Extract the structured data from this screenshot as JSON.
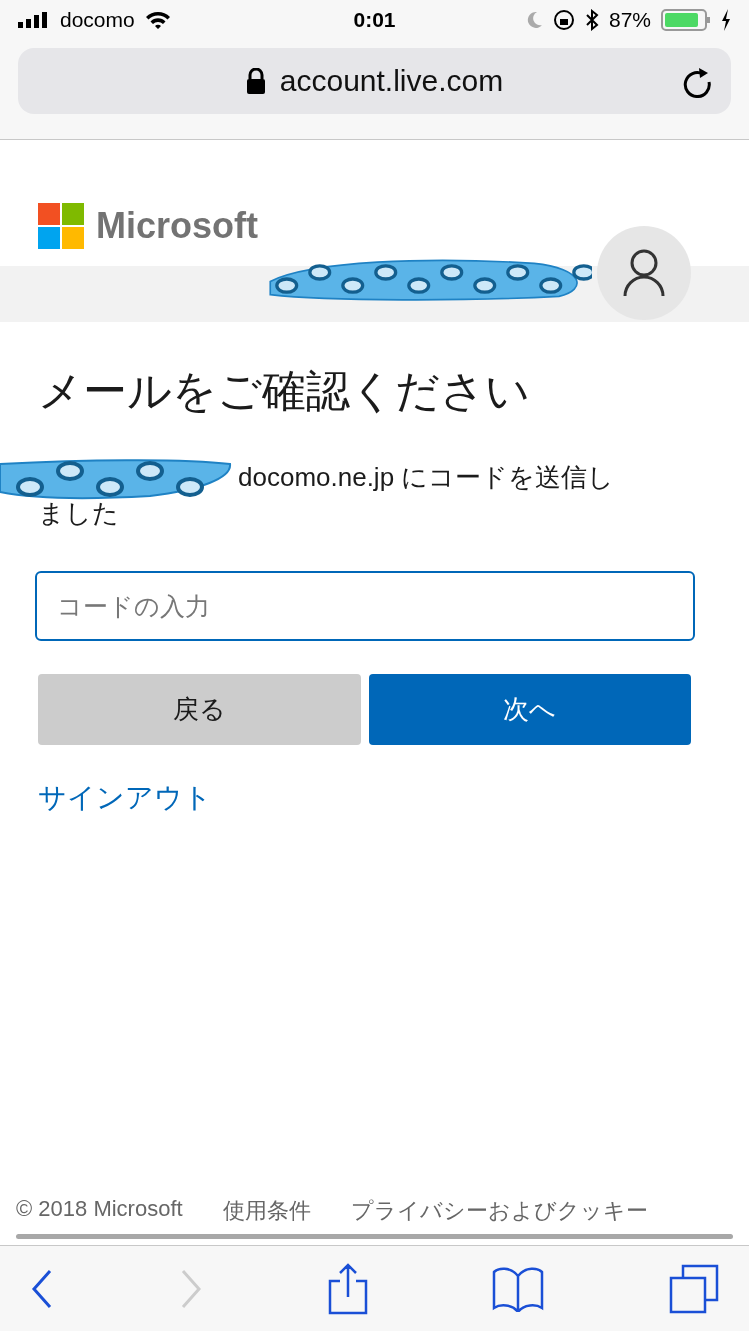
{
  "status_bar": {
    "carrier": "docomo",
    "time": "0:01",
    "battery": "87%"
  },
  "address_bar": {
    "url": "account.live.com"
  },
  "brand": {
    "name": "Microsoft"
  },
  "heading": "メールをご確認ください",
  "message": {
    "line_1": "docomo.ne.jp にコードを送信し",
    "line_2": "ました"
  },
  "code_field": {
    "placeholder": "コードの入力"
  },
  "buttons": [
    {
      "label": "戻る",
      "kind": "secondary"
    },
    {
      "label": "次へ",
      "kind": "primary"
    }
  ],
  "sign_out": "サインアウト",
  "footer": [
    "© 2018 Microsoft",
    "使用条件",
    "プライバシーおよびクッキー"
  ],
  "toolbar": {
    "forward_disabled": true
  }
}
